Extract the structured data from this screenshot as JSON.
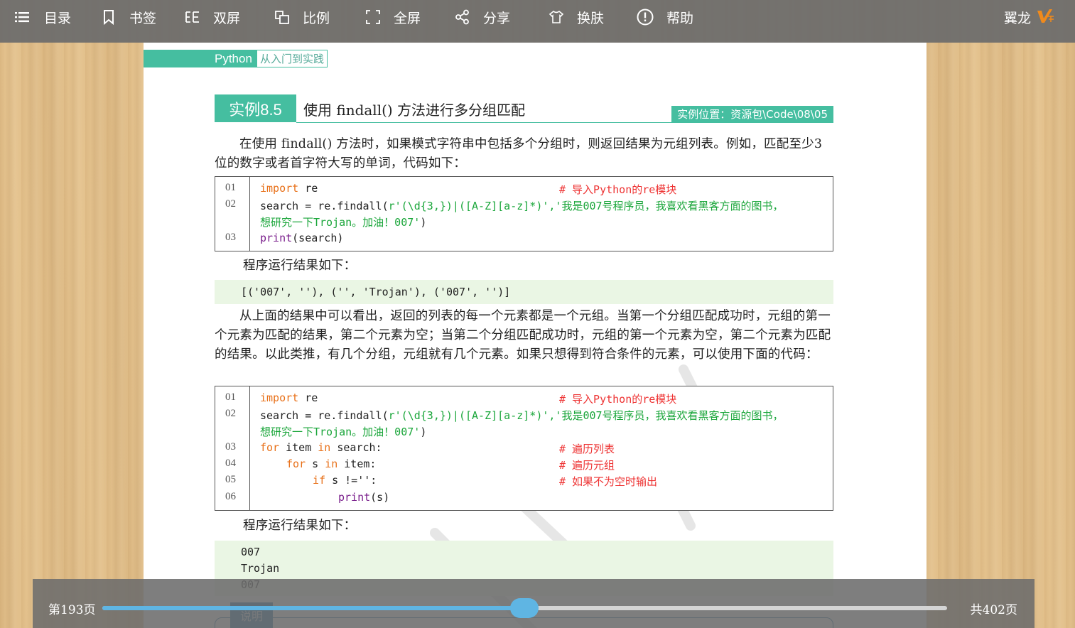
{
  "toolbar": {
    "items": [
      {
        "label": "目录",
        "icon": "list-icon"
      },
      {
        "label": "书签",
        "icon": "bookmark-icon"
      },
      {
        "label": "双屏",
        "icon": "dual-screen-icon"
      },
      {
        "label": "比例",
        "icon": "ratio-icon"
      },
      {
        "label": "全屏",
        "icon": "fullscreen-icon"
      },
      {
        "label": "分享",
        "icon": "share-icon"
      },
      {
        "label": "换肤",
        "icon": "skin-icon"
      },
      {
        "label": "帮助",
        "icon": "help-icon"
      }
    ],
    "brand": "翼龙"
  },
  "page": {
    "header_tag": "Python",
    "header_sub": "从入门到实践",
    "example_badge": "实例8.5",
    "example_title": "使用 findall() 方法进行多分组匹配",
    "example_location": "实例位置：资源包\\Code\\08\\05",
    "para1": "在使用 findall() 方法时，如果模式字符串中包括多个分组时，则返回结果为元组列表。例如，匹配至少3位的数字或者首字符大写的单词，代码如下：",
    "code1": {
      "l1_num": "01",
      "l1_kw": "import",
      "l1_rest": " re",
      "l1_cmt": "#  导入Python的re模块",
      "l2_num": "02",
      "l2_pre": "search = re.findall(",
      "l2_str": "r'(\\d{3,})|([A-Z][a-z]*)','我是007号程序员，我喜欢看黑客方面的图书，",
      "l2b_str": "想研究一下Trojan。加油！007'",
      "l2b_end": ")",
      "l3_num": "03",
      "l3_fn": "print",
      "l3_rest": "(search)"
    },
    "result_label_1": "程序运行结果如下：",
    "output1": "[('007', ''), ('', 'Trojan'), ('007', '')]",
    "para2": "从上面的结果中可以看出，返回的列表的每一个元素都是一个元组。当第一个分组匹配成功时，元组的第一个元素为匹配的结果，第二个元素为空；当第二个分组匹配成功时，元组的第一个元素为空，第二个元素为匹配的结果。以此类推，有几个分组，元组就有几个元素。如果只想得到符合条件的元素，可以使用下面的代码：",
    "code2": {
      "l1_num": "01",
      "l1_kw": "import",
      "l1_rest": " re",
      "l1_cmt": "#  导入Python的re模块",
      "l2_num": "02",
      "l2_pre": "search = re.findall(",
      "l2_str": "r'(\\d{3,})|([A-Z][a-z]*)','我是007号程序员，我喜欢看黑客方面的图书，",
      "l2b_str": "想研究一下Trojan。加油！007'",
      "l2b_end": ")",
      "l3_num": "03",
      "l3_kw1": "for",
      "l3_mid": " item ",
      "l3_kw2": "in",
      "l3_rest": " search:",
      "l3_cmt": "#  遍历列表",
      "l4_num": "04",
      "l4_kw1": "for",
      "l4_mid": " s ",
      "l4_kw2": "in",
      "l4_rest": " item:",
      "l4_cmt": "#  遍历元组",
      "l5_num": "05",
      "l5_kw": "if",
      "l5_rest": " s !='':",
      "l5_cmt": "#  如果不为空时输出",
      "l6_num": "06",
      "l6_fn": "print",
      "l6_rest": "(s)"
    },
    "result_label_2": "程序运行结果如下：",
    "output2": [
      "007",
      "Trojan",
      "007"
    ],
    "note_badge": "说明"
  },
  "pager": {
    "current": "第193页",
    "total": "共402页",
    "progress": 0.4996
  },
  "colors": {
    "accent_green": "#45bea0",
    "slider_blue": "#5fb5e3",
    "keyword_orange": "#e8711a",
    "string_green": "#1aa63a",
    "comment_red": "#ee3333",
    "toolbar_gray": "#6c6c6c"
  }
}
